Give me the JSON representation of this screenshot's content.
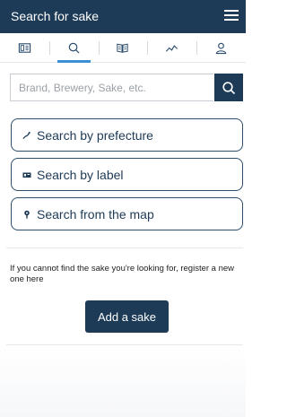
{
  "header": {
    "title": "Search for sake",
    "menu_icon": "hamburger-menu-icon"
  },
  "tabs": [
    {
      "icon": "sake-list-icon",
      "active": false
    },
    {
      "icon": "search-icon",
      "active": true
    },
    {
      "icon": "book-icon",
      "active": false
    },
    {
      "icon": "ranking-chart-icon",
      "active": false
    },
    {
      "icon": "user-icon",
      "active": false
    }
  ],
  "search": {
    "placeholder": "Brand, Brewery, Sake, etc.",
    "value": ""
  },
  "options": {
    "prefecture": {
      "label": "Search by prefecture",
      "icon": "map-region-icon"
    },
    "label": {
      "label": "Search by label",
      "icon": "label-image-icon"
    },
    "map": {
      "label": "Search from the map",
      "icon": "map-pin-icon"
    }
  },
  "register": {
    "message": "If you cannot find the sake you're looking for, register a new one here",
    "button_label": "Add a sake"
  },
  "colors": {
    "primary": "#1d3a57",
    "accent": "#3d8fd4",
    "border": "#c9ced4"
  }
}
